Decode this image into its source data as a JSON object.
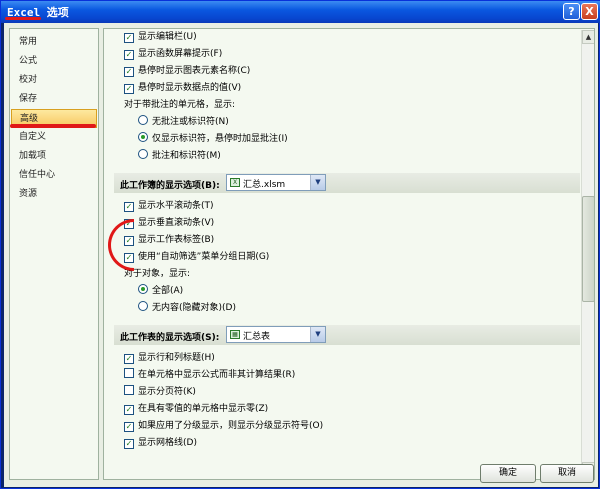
{
  "window": {
    "title": "Excel 选项",
    "help_label": "?",
    "close_label": "X"
  },
  "sidebar": {
    "items": [
      {
        "label": "常用"
      },
      {
        "label": "公式"
      },
      {
        "label": "校对"
      },
      {
        "label": "保存"
      },
      {
        "label": "高级",
        "selected": true
      },
      {
        "label": "自定义"
      },
      {
        "label": "加载项"
      },
      {
        "label": "信任中心"
      },
      {
        "label": "资源"
      }
    ]
  },
  "content": {
    "top_checks": [
      {
        "label": "显示编辑栏(U)",
        "checked": true
      },
      {
        "label": "显示函数屏幕提示(F)",
        "checked": true
      },
      {
        "label": "悬停时显示图表元素名称(C)",
        "checked": true
      },
      {
        "label": "悬停时显示数据点的值(V)",
        "checked": true
      }
    ],
    "comments_heading": "对于带批注的单元格，显示:",
    "comments_options": [
      {
        "label": "无批注或标识符(N)",
        "selected": false
      },
      {
        "label": "仅显示标识符，悬停时加显批注(I)",
        "selected": true
      },
      {
        "label": "批注和标识符(M)",
        "selected": false
      }
    ],
    "workbook_section": {
      "label": "此工作簿的显示选项(B):",
      "file": "汇总.xlsm",
      "icon": "excel-file-icon"
    },
    "workbook_checks": [
      {
        "label": "显示水平滚动条(T)",
        "checked": true
      },
      {
        "label": "显示垂直滚动条(V)",
        "checked": true
      },
      {
        "label": "显示工作表标签(B)",
        "checked": true
      },
      {
        "label": "使用“自动筛选”菜单分组日期(G)",
        "checked": true
      }
    ],
    "objects_heading": "对于对象，显示:",
    "objects_options": [
      {
        "label": "全部(A)",
        "selected": true
      },
      {
        "label": "无内容(隐藏对象)(D)",
        "selected": false
      }
    ],
    "sheet_section": {
      "label": "此工作表的显示选项(S):",
      "sheet": "汇总表",
      "icon": "sheet-icon"
    },
    "sheet_checks": [
      {
        "label": "显示行和列标题(H)",
        "checked": true
      },
      {
        "label": "在单元格中显示公式而非其计算结果(R)",
        "checked": false
      },
      {
        "label": "显示分页符(K)",
        "checked": false
      },
      {
        "label": "在具有零值的单元格中显示零(Z)",
        "checked": true
      },
      {
        "label": "如果应用了分级显示，则显示分级显示符号(O)",
        "checked": true
      },
      {
        "label": "显示网格线(D)",
        "checked": true
      }
    ]
  },
  "footer": {
    "ok_label": "确定",
    "cancel_label": "取消"
  },
  "colors": {
    "titlebar": "#0a58e0",
    "selection": "#f8c860",
    "annotation": "#e01818"
  }
}
